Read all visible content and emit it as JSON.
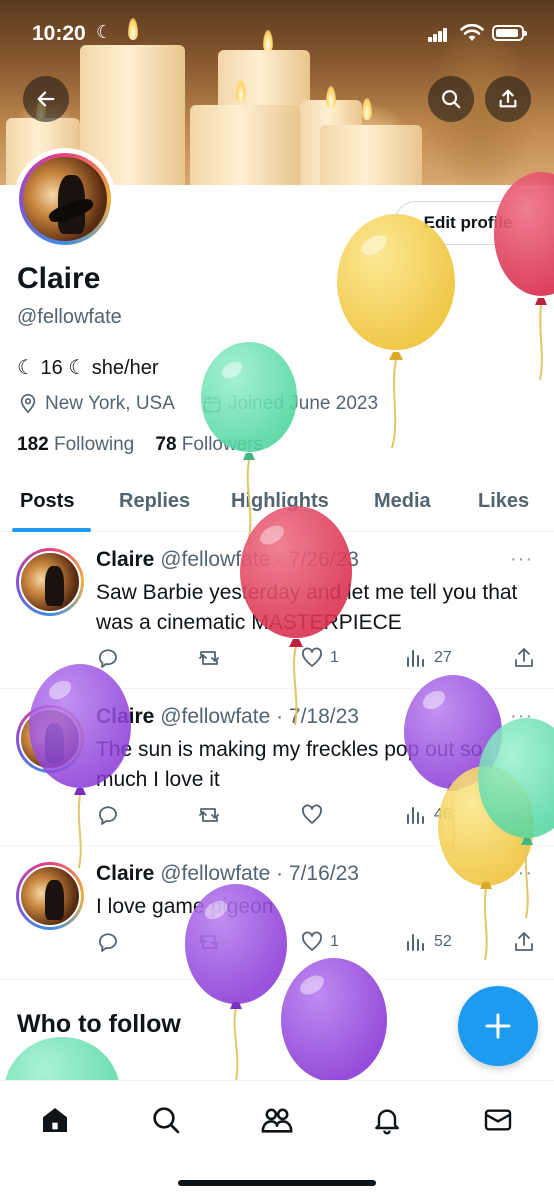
{
  "status_bar": {
    "time": "10:20",
    "moon": "☾"
  },
  "profile": {
    "name": "Claire",
    "handle": "@fellowfate",
    "bio": "☾ 16 ☾ she/her",
    "location": "New York, USA",
    "joined": "Joined June 2023",
    "following_count": "182",
    "following_label": "Following",
    "followers_count": "78",
    "followers_label": "Followers",
    "edit_button": "Edit profile"
  },
  "tabs": [
    {
      "label": "Posts"
    },
    {
      "label": "Replies"
    },
    {
      "label": "Highlights"
    },
    {
      "label": "Media"
    },
    {
      "label": "Likes"
    }
  ],
  "tweets": [
    {
      "name": "Claire",
      "meta": "@fellowfate · 7/26/23",
      "text": "Saw Barbie yesterday and let me tell you that was a cinematic MASTERPIECE",
      "likes": "1",
      "views": "27"
    },
    {
      "name": "Claire",
      "meta": "@fellowfate · 7/18/23",
      "text": "The sun is making my freckles pop out so much I love it",
      "likes": "",
      "views": "46"
    },
    {
      "name": "Claire",
      "meta": "@fellowfate · 7/16/23",
      "text": "I love game pigeon",
      "likes": "1",
      "views": "52"
    }
  ],
  "more_glyph": "···",
  "who_to_follow": {
    "title": "Who to follow"
  },
  "colors": {
    "accent": "#1d9bf0",
    "text_secondary": "#536471",
    "balloon_yellow": "#f5d24f",
    "balloon_pink": "#e24a64",
    "balloon_mint": "#6fe0b4",
    "balloon_purple": "#9b4fe0"
  },
  "icons": [
    "back-arrow-icon",
    "search-icon",
    "share-icon",
    "location-pin-icon",
    "calendar-icon",
    "reply-icon",
    "retweet-icon",
    "heart-icon",
    "views-icon",
    "share-icon",
    "plus-icon",
    "home-icon",
    "communities-icon",
    "bell-icon",
    "mail-icon"
  ]
}
